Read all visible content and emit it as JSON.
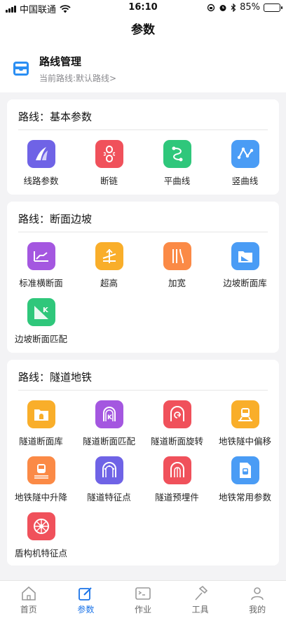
{
  "status": {
    "carrier": "中国联通",
    "time": "16:10",
    "battery": "85%",
    "battery_level": 0.85
  },
  "header": {
    "title": "参数"
  },
  "route": {
    "title": "路线管理",
    "subtitle": "当前路线:默认路线",
    "chevron": ">"
  },
  "sections": [
    {
      "title": "路线：基本参数",
      "items": [
        {
          "label": "线路参数",
          "icon": "road-icon",
          "color": "#6f63e6"
        },
        {
          "label": "断链",
          "icon": "broken-chain-icon",
          "color": "#f0515b"
        },
        {
          "label": "平曲线",
          "icon": "horizontal-curve-icon",
          "color": "#2fc77b"
        },
        {
          "label": "竖曲线",
          "icon": "vertical-curve-icon",
          "color": "#4a9cf5"
        }
      ]
    },
    {
      "title": "路线：断面边坡",
      "items": [
        {
          "label": "标准横断面",
          "icon": "cross-section-icon",
          "color": "#a457e0"
        },
        {
          "label": "超高",
          "icon": "superelevation-icon",
          "color": "#f9ae2a"
        },
        {
          "label": "加宽",
          "icon": "widening-icon",
          "color": "#fb8a46"
        },
        {
          "label": "边坡断面库",
          "icon": "slope-library-icon",
          "color": "#4a9cf5"
        },
        {
          "label": "边坡断面匹配",
          "icon": "slope-match-icon",
          "color": "#2fc77b"
        }
      ]
    },
    {
      "title": "路线：隧道地铁",
      "items": [
        {
          "label": "隧道断面库",
          "icon": "tunnel-library-icon",
          "color": "#f9ae2a"
        },
        {
          "label": "隧道断面匹配",
          "icon": "tunnel-match-icon",
          "color": "#a457e0"
        },
        {
          "label": "隧道断面旋转",
          "icon": "tunnel-rotate-icon",
          "color": "#f0515b"
        },
        {
          "label": "地铁隧中偏移",
          "icon": "metro-offset-icon",
          "color": "#f9ae2a"
        },
        {
          "label": "地铁隧中升降",
          "icon": "metro-lift-icon",
          "color": "#fb8a46"
        },
        {
          "label": "隧道特征点",
          "icon": "tunnel-feature-icon",
          "color": "#6f63e6"
        },
        {
          "label": "隧道预埋件",
          "icon": "tunnel-embedded-icon",
          "color": "#f0515b"
        },
        {
          "label": "地铁常用参数",
          "icon": "metro-params-icon",
          "color": "#4a9cf5"
        },
        {
          "label": "盾构机特征点",
          "icon": "shield-machine-icon",
          "color": "#f0515b"
        }
      ]
    }
  ],
  "tabs": [
    {
      "label": "首页",
      "icon": "home-icon"
    },
    {
      "label": "参数",
      "icon": "edit-icon",
      "active": true
    },
    {
      "label": "作业",
      "icon": "terminal-icon"
    },
    {
      "label": "工具",
      "icon": "hammer-icon"
    },
    {
      "label": "我的",
      "icon": "user-icon"
    }
  ]
}
